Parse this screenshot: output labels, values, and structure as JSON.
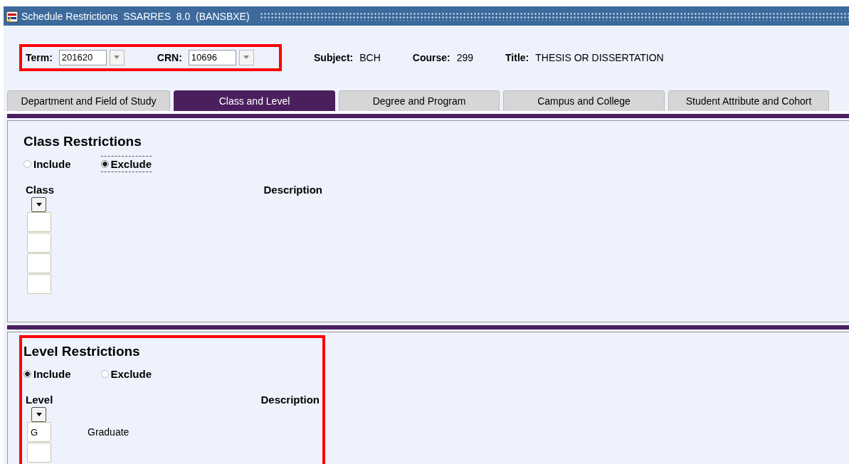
{
  "window": {
    "title": "Schedule Restrictions  SSARRES  8.0  (BANSBXE)"
  },
  "key_block": {
    "term": {
      "label": "Term:",
      "value": "201620"
    },
    "crn": {
      "label": "CRN:",
      "value": "10696"
    },
    "info": [
      {
        "label": "Subject:",
        "value": "BCH"
      },
      {
        "label": "Course:",
        "value": "299"
      },
      {
        "label": "Title:",
        "value": "THESIS OR DISSERTATION"
      }
    ]
  },
  "tabs": [
    {
      "label": "Department and Field of Study",
      "selected": false
    },
    {
      "label": "Class and Level",
      "selected": true
    },
    {
      "label": "Degree and Program",
      "selected": false
    },
    {
      "label": "Campus and College",
      "selected": false
    },
    {
      "label": "Student Attribute and Cohort",
      "selected": false
    }
  ],
  "sections": [
    {
      "title": "Class Restrictions",
      "highlighted": false,
      "options": [
        {
          "label": "Include",
          "selected": false
        },
        {
          "label": "Exclude",
          "selected": true
        }
      ],
      "code_header": "Class",
      "description_header": "Description",
      "rows": [
        {},
        {},
        {},
        {}
      ]
    },
    {
      "title": "Level Restrictions",
      "highlighted": true,
      "options": [
        {
          "label": "Include",
          "selected": true
        },
        {
          "label": "Exclude",
          "selected": false
        }
      ],
      "code_header": "Level",
      "description_header": "Description",
      "rows": [
        {
          "code": "G",
          "description": "Graduate"
        },
        {}
      ]
    }
  ]
}
